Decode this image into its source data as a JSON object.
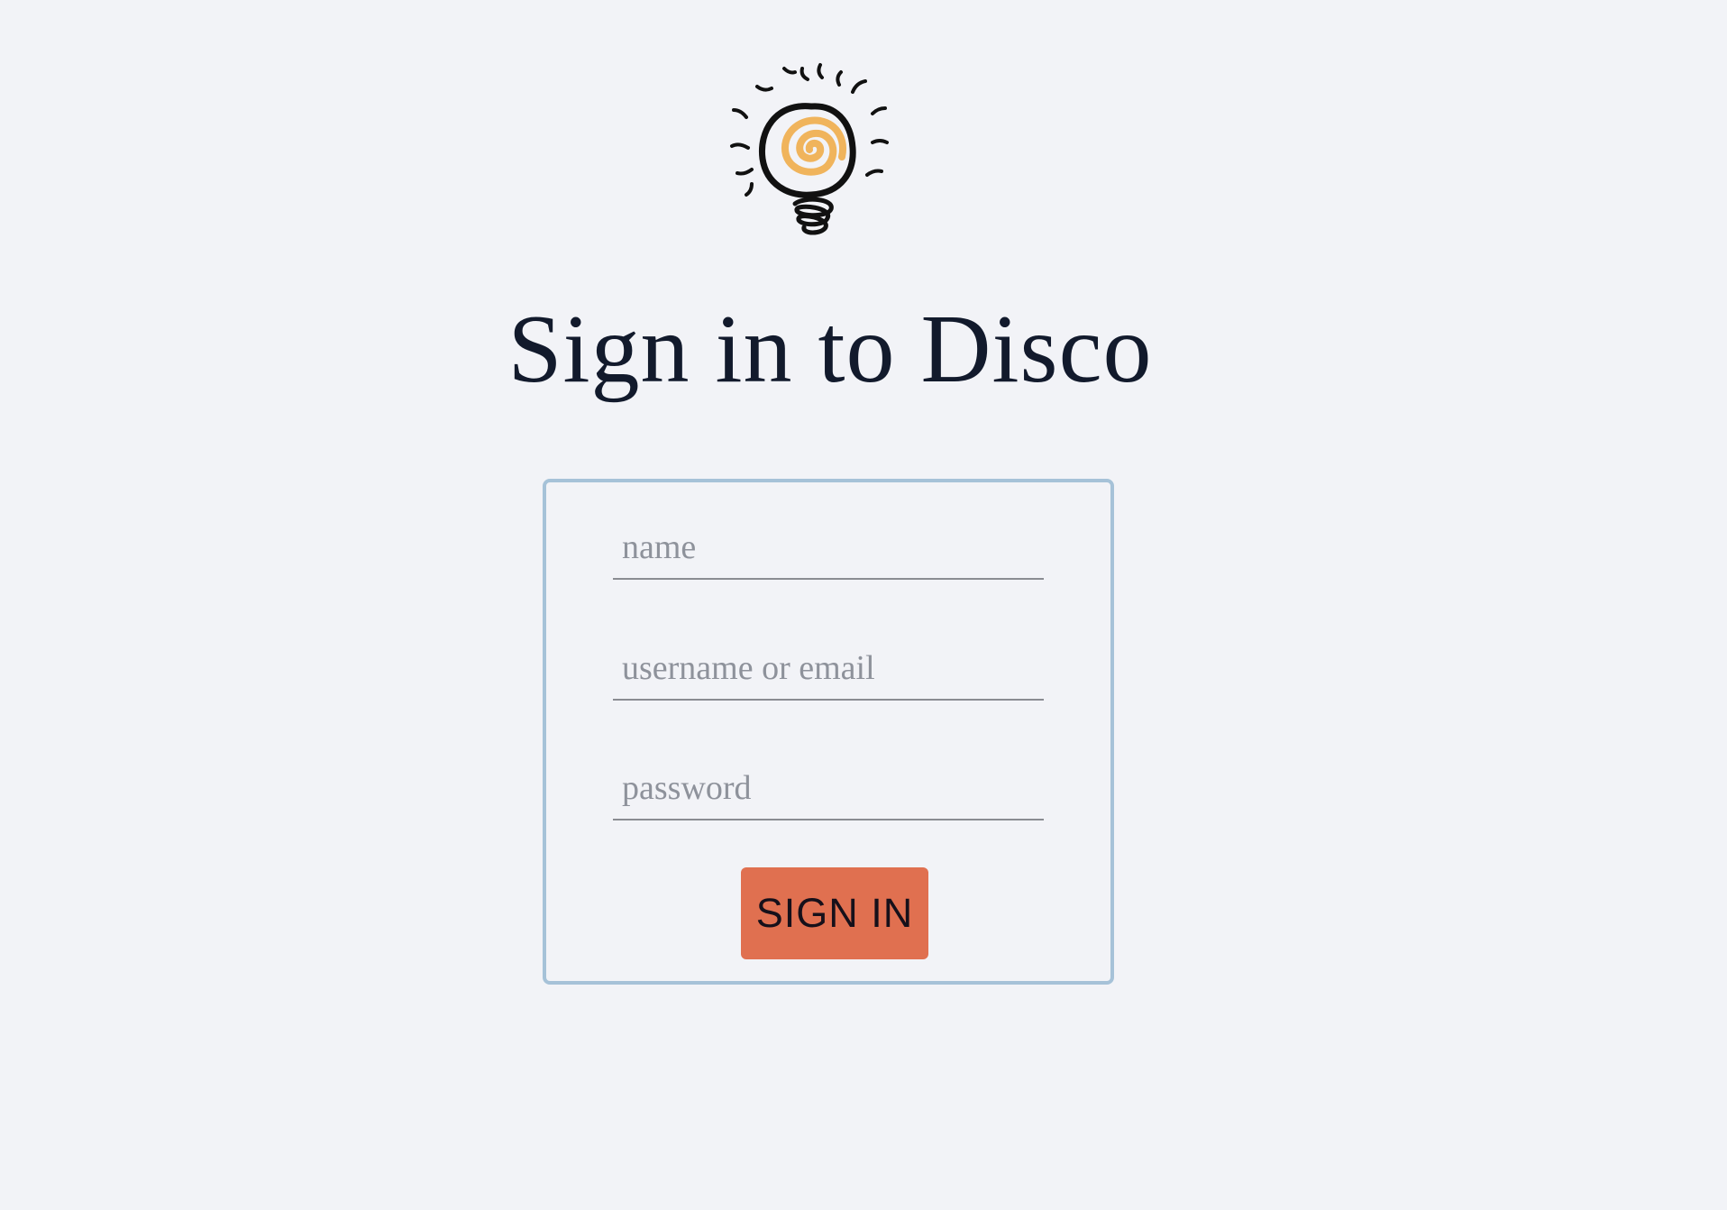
{
  "brand": {
    "logo_icon": "lightbulb-logo-icon",
    "accent_color": "#f0b45c"
  },
  "heading": {
    "title": "Sign in to Disco"
  },
  "form": {
    "name_placeholder": "name",
    "name_value": "",
    "username_placeholder": "username or email",
    "username_value": "",
    "password_placeholder": "password",
    "password_value": "",
    "submit_label": "SIGN IN",
    "submit_color": "#e07050",
    "border_color": "#a6c2d8"
  }
}
